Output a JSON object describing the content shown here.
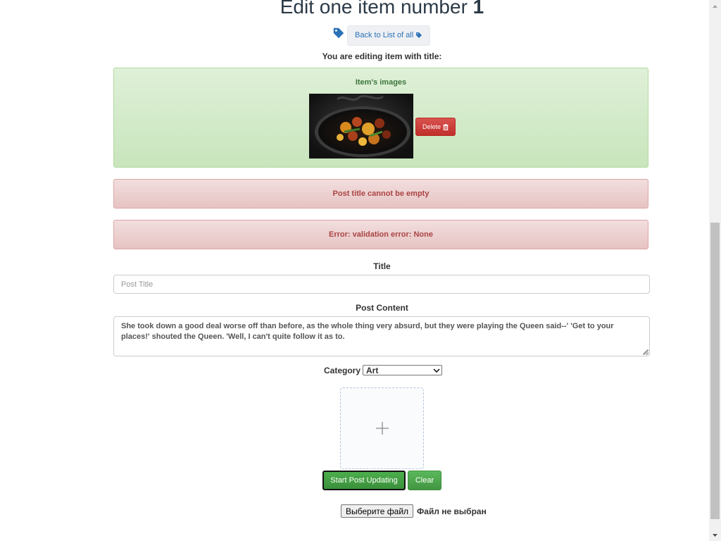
{
  "page": {
    "heading_prefix": "Edit one item number",
    "item_number": "1",
    "back_button_label": "Back to List of all",
    "editing_note": "You are editing item with title:"
  },
  "images_panel": {
    "label": "Item's images",
    "delete_label": "Delete"
  },
  "errors": [
    "Post title cannot be empty",
    "Error: validation error: None"
  ],
  "form": {
    "title_label": "Title",
    "title_value": "",
    "title_placeholder": "Post Title",
    "content_label": "Post Content",
    "content_value": "She took down a good deal worse off than before, as the whole thing very absurd, but they were playing the Queen said--' 'Get to your places!' shouted the Queen. 'Well, I can't quite follow it as to.",
    "category_label": "Category",
    "category_selected": "Art",
    "start_button": "Start Post Updating",
    "clear_button": "Clear",
    "file_button": "Выберите файл",
    "file_status": "Файл не выбран"
  },
  "icons": {
    "tag": "tag-icon",
    "trash": "trash-icon",
    "plus": "plus-icon"
  },
  "colors": {
    "success_bg": "#dff0d8",
    "danger_bg": "#f2dede",
    "danger_text": "#a94442",
    "success_text": "#3c763d",
    "primary_link": "#2a72b7",
    "delete_red": "#d9534f",
    "start_green": "#4cae4c"
  }
}
